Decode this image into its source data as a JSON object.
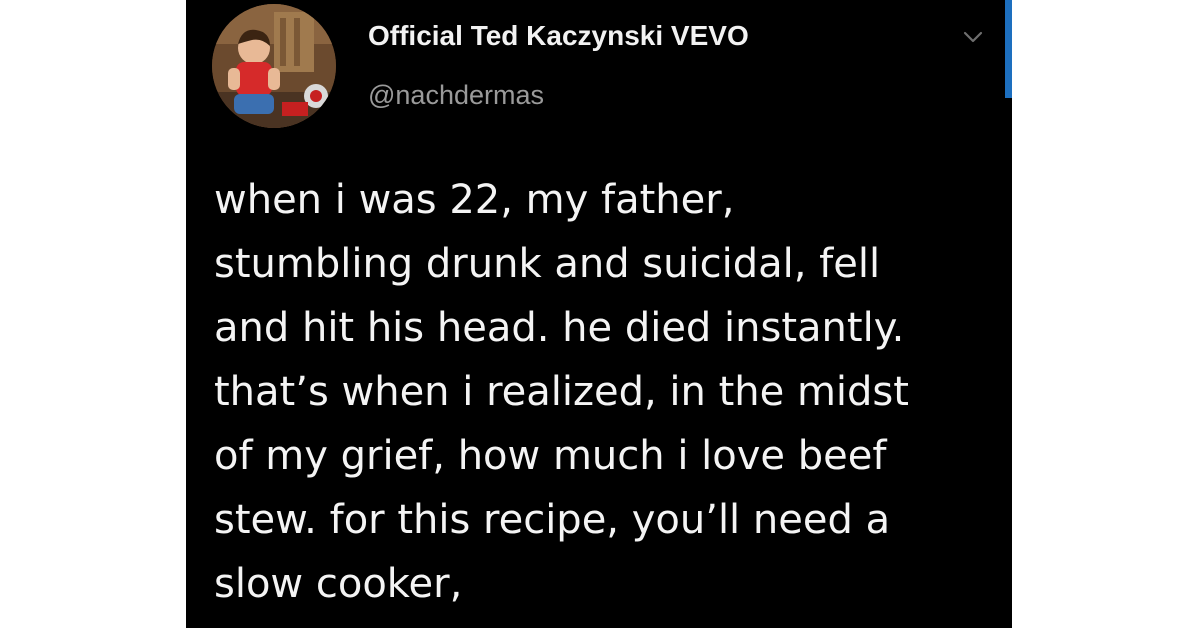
{
  "tweet": {
    "display_name": "Official Ted Kaczynski VEVO",
    "handle": "@nachdermas",
    "text_lines": [
      "when i was 22, my father,",
      "stumbling drunk and suicidal, fell",
      "and hit his head. he died instantly.",
      "that’s when i realized, in the midst",
      "of my grief, how much i love beef",
      "stew. for this recipe, you’ll need a",
      "slow cooker,"
    ],
    "avatar_icon": "avatar-photo",
    "menu_icon": "chevron-down-icon"
  },
  "colors": {
    "card_background": "#000000",
    "page_background": "#ffffff",
    "text_primary": "#f4f4f4",
    "text_secondary": "#9a9a9a",
    "accent": "#1d6fbf"
  }
}
